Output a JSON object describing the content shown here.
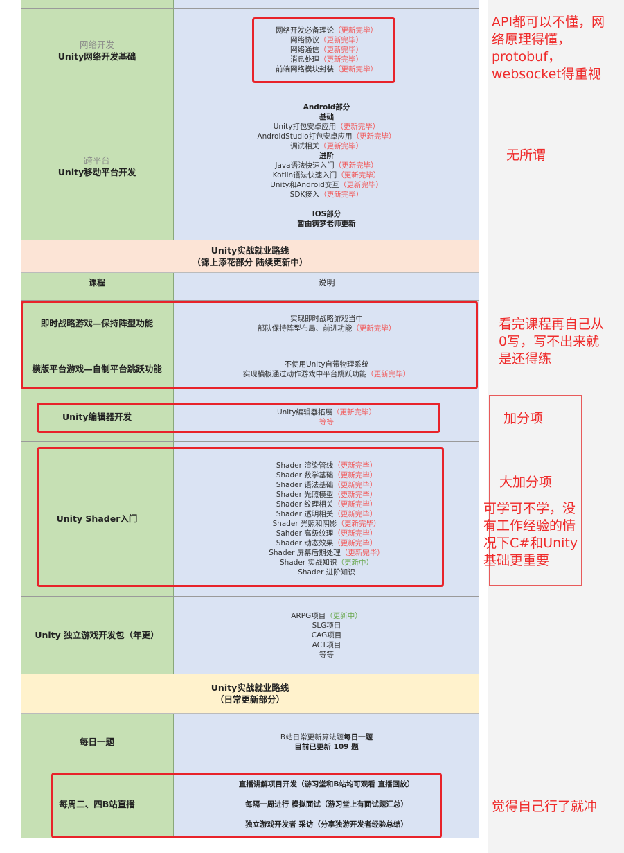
{
  "rows": {
    "network": {
      "left_gray": "网络开发",
      "left_bold": "Unity网络开发基础",
      "lines": [
        {
          "text": "网络开发必备理论",
          "status": "（更新完毕）"
        },
        {
          "text": "网络协议",
          "status": "（更新完毕）"
        },
        {
          "text": "网络通信",
          "status": "（更新完毕）"
        },
        {
          "text": "消息处理",
          "status": "（更新完毕）"
        },
        {
          "text": "前端网络模块封装",
          "status": "（更新完毕）"
        }
      ]
    },
    "mobile": {
      "left_gray": "跨平台",
      "left_bold": "Unity移动平台开发",
      "android_header": "Android部分",
      "basic_header": "基础",
      "basic_lines": [
        {
          "text": "Unity打包安卓应用",
          "status": "（更新完毕）"
        },
        {
          "text": "AndroidStudio打包安卓应用",
          "status": "（更新完毕）"
        },
        {
          "text": "调试相关",
          "status": "（更新完毕）"
        }
      ],
      "advanced_header": "进阶",
      "advanced_lines": [
        {
          "text": "Java语法快速入门",
          "status": "（更新完毕）"
        },
        {
          "text": "Kotlin语法快速入门",
          "status": "（更新完毕）"
        },
        {
          "text": "Unity和Android交互",
          "status": "（更新完毕）"
        },
        {
          "text": "SDK接入",
          "status": "（更新完毕）"
        }
      ],
      "ios_header": "IOS部分",
      "ios_note": "暂由铸梦老师更新"
    },
    "band1": {
      "title": "Unity实战就业路线",
      "subtitle": "（锦上添花部分 陆续更新中）"
    },
    "header": {
      "col1": "课程",
      "col2": "说明"
    },
    "rts": {
      "left": "即时战略游戏—保持阵型功能",
      "line1": "实现即时战略游戏当中",
      "line2": "部队保持阵型布局、前进功能",
      "status": "（更新完毕）"
    },
    "platformer": {
      "left": "横版平台游戏—自制平台跳跃功能",
      "line1": "不使用Unity自带物理系统",
      "line2": "实现横板通过动作游戏中平台跳跃功能",
      "status": "（更新完毕）"
    },
    "editor": {
      "left": "Unity编辑器开发",
      "line1": "Unity编辑器拓展",
      "status": "（更新完毕）",
      "line2": "等等"
    },
    "shader": {
      "left": "Unity Shader入门",
      "lines": [
        {
          "text": "Shader 渲染管线",
          "status": "（更新完毕）",
          "tone": "red"
        },
        {
          "text": "Shader 数学基础",
          "status": "（更新完毕）",
          "tone": "red"
        },
        {
          "text": "Shader 语法基础",
          "status": "（更新完毕）",
          "tone": "red"
        },
        {
          "text": "Shader 光照模型",
          "status": "（更新完毕）",
          "tone": "red"
        },
        {
          "text": "Shader 纹理相关",
          "status": "（更新完毕）",
          "tone": "red"
        },
        {
          "text": "Shader 透明相关",
          "status": "（更新完毕）",
          "tone": "red"
        },
        {
          "text": "Shader 光照和阴影",
          "status": "（更新完毕）",
          "tone": "red"
        },
        {
          "text": "Sahder 高级纹理",
          "status": "（更新完毕）",
          "tone": "red"
        },
        {
          "text": "Shader 动态效果",
          "status": "（更新完毕）",
          "tone": "red"
        },
        {
          "text": "Shader 屏幕后期处理",
          "status": "（更新完毕）",
          "tone": "red"
        },
        {
          "text": "Shader 实战知识",
          "status": "（更新中）",
          "tone": "green"
        },
        {
          "text": "Shader 进阶知识",
          "status": "",
          "tone": "red"
        }
      ]
    },
    "indie": {
      "left": "Unity 独立游戏开发包（年更）",
      "lines": [
        {
          "text": "ARPG项目",
          "status": "（更新中）",
          "tone": "green"
        },
        {
          "text": "SLG项目",
          "status": "",
          "tone": "red"
        },
        {
          "text": "CAG项目",
          "status": "",
          "tone": "red"
        },
        {
          "text": "ACT项目",
          "status": "",
          "tone": "red"
        },
        {
          "text": "等等",
          "status": "",
          "tone": "red"
        }
      ]
    },
    "band2": {
      "title": "Unity实战就业路线",
      "subtitle": "（日常更新部分）"
    },
    "daily": {
      "left": "每日一题",
      "line1_prefix": "B站日常更新算法题",
      "line1_bold": "每日一题",
      "line2": "目前已更新 109 题"
    },
    "live": {
      "left": "每周二、四B站直播",
      "lines": [
        "直播讲解项目开发（游习堂和B站均可观看 直播回放）",
        "每隔一周进行 模拟面试（游习堂上有面试题汇总）",
        "独立游戏开发者 采访（分享独游开发者经验总结）"
      ]
    }
  },
  "annotations": {
    "network_note": [
      "API都可以不懂，网",
      "络原理得懂，",
      "protobuf，",
      "websocket得重视"
    ],
    "mobile_note": "无所谓",
    "projects_note": [
      "看完课程再自己从",
      "0写，写不出来就",
      "是还得练"
    ],
    "editor_note": "加分项",
    "shader_note": "大加分项",
    "shader_note2": [
      "可学可不学，没",
      "有工作经验的情",
      "况下C#和Unity",
      "基础更重要"
    ],
    "live_note": "觉得自己行了就冲"
  },
  "colors": {
    "left_green": "#c6e0b4",
    "right_blue": "#dae3f3",
    "band_peach": "#fce4d6",
    "band_yellow": "#fff2cc",
    "status_red": "#f25757",
    "status_green": "#6aa84f",
    "annotation_red": "#ef2b2b"
  }
}
